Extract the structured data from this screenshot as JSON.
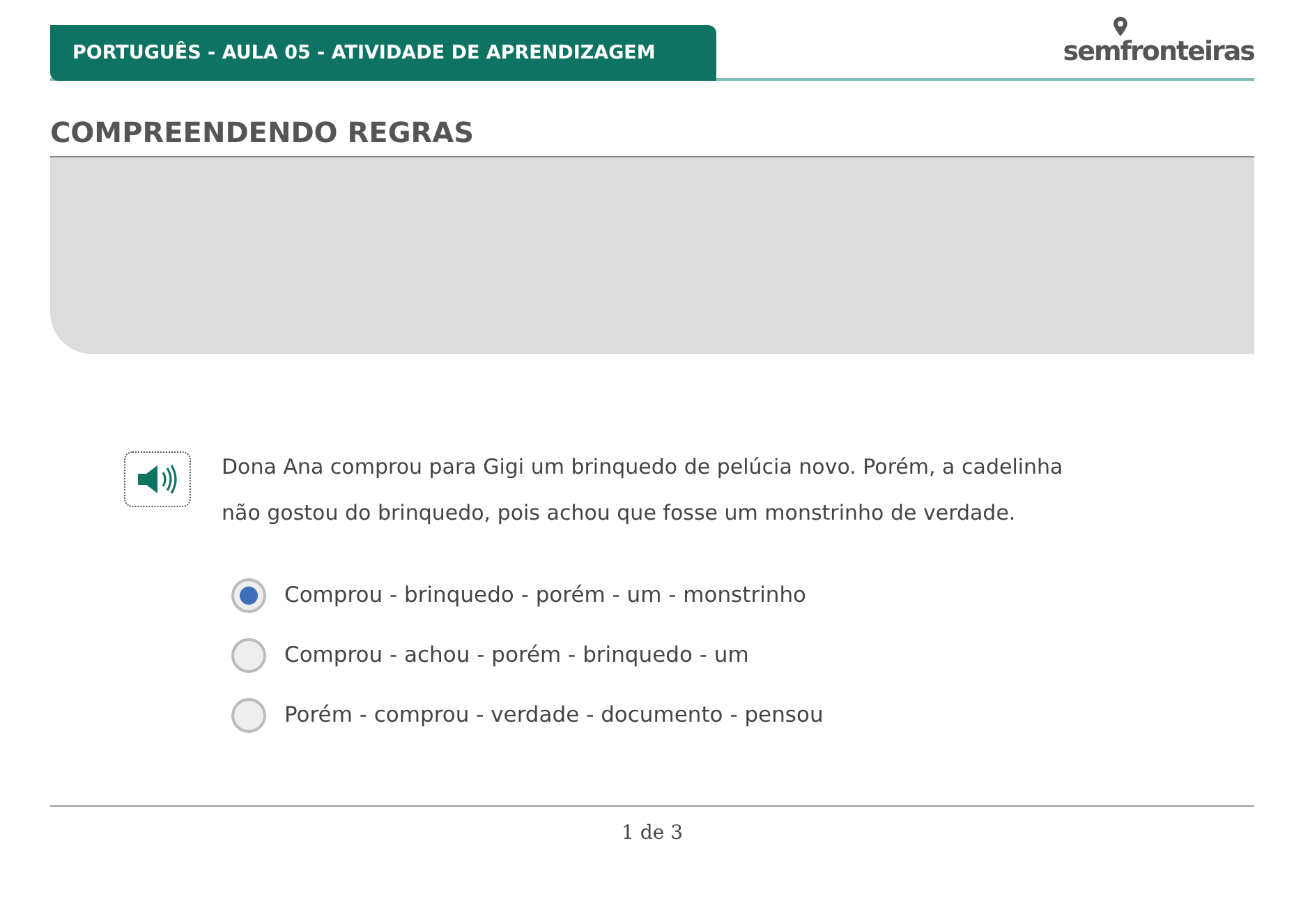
{
  "header": {
    "title": "PORTUGUÊS - AULA 05 - ATIVIDADE DE APRENDIZAGEM",
    "logo": "semfronteiras"
  },
  "section_title": "COMPREENDENDO REGRAS",
  "question": {
    "text": "Dona Ana comprou para Gigi um brinquedo de pelúcia novo. Porém, a cadelinha não gostou do brinquedo, pois achou que fosse um monstrinho de verdade."
  },
  "options": [
    {
      "label": "Comprou - brinquedo - porém - um - monstrinho",
      "selected": true
    },
    {
      "label": "Comprou - achou - porém - brinquedo - um",
      "selected": false
    },
    {
      "label": "Porém - comprou - verdade - documento - pensou",
      "selected": false
    }
  ],
  "pagination": "1 de 3"
}
